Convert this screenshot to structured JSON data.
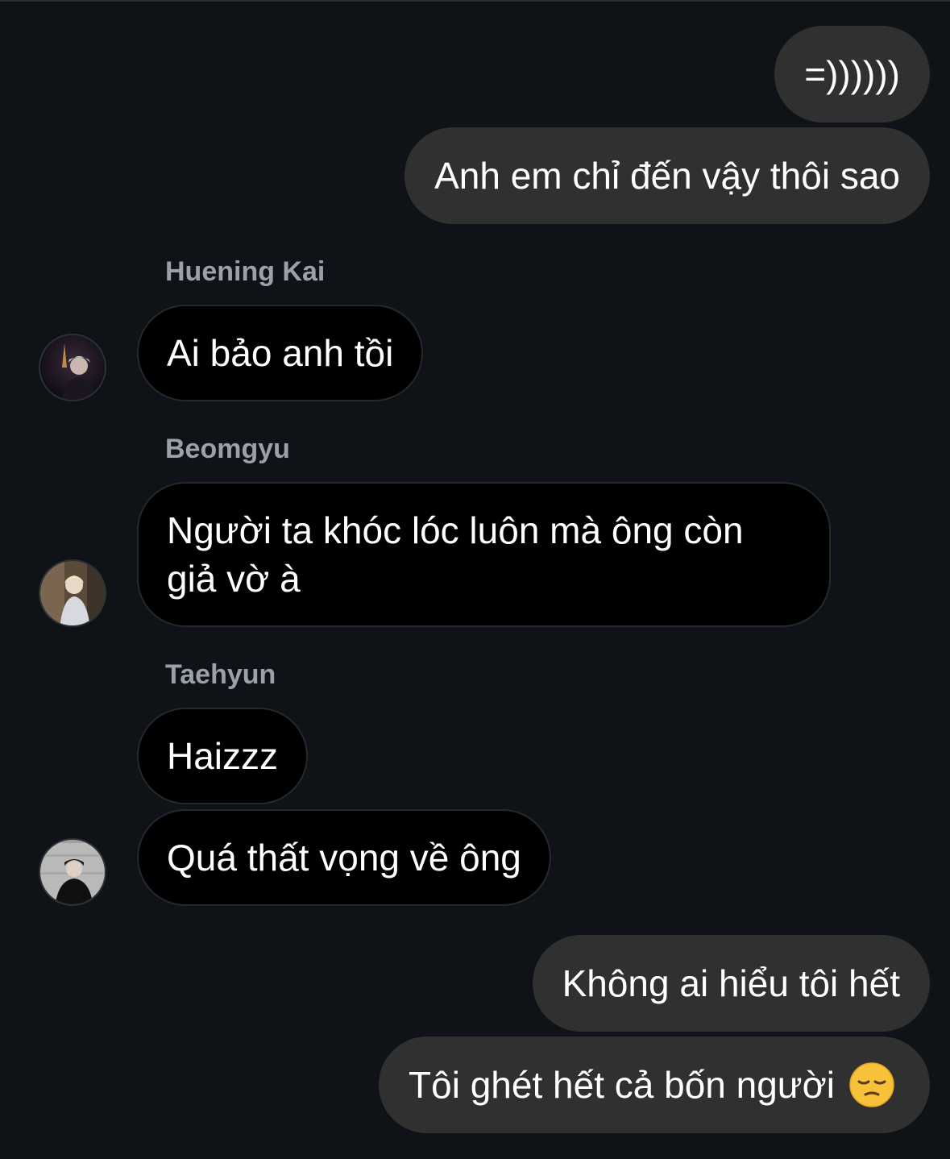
{
  "messages": [
    {
      "dir": "out",
      "text": "=))))))"
    },
    {
      "dir": "out",
      "text": "Anh em chỉ đến vậy thôi sao"
    },
    {
      "dir": "in",
      "sender": "Huening Kai",
      "text": "Ai bảo anh tồi"
    },
    {
      "dir": "in",
      "sender": "Beomgyu",
      "text": "Người ta khóc lóc luôn mà ông còn giả vờ à"
    },
    {
      "dir": "in",
      "sender": "Taehyun",
      "text": "Haizzz"
    },
    {
      "dir": "in",
      "sender": "Taehyun",
      "text": "Quá thất vọng về ông"
    },
    {
      "dir": "out",
      "text": "Không ai hiểu tôi hết"
    },
    {
      "dir": "out",
      "text": "Tôi ghét hết cả bốn người",
      "emoji": "pensive-face"
    }
  ],
  "colors": {
    "background": "#0f1317",
    "outgoing_bubble": "#303030",
    "incoming_bubble": "#000000",
    "sender_name": "#9aa1ab"
  }
}
